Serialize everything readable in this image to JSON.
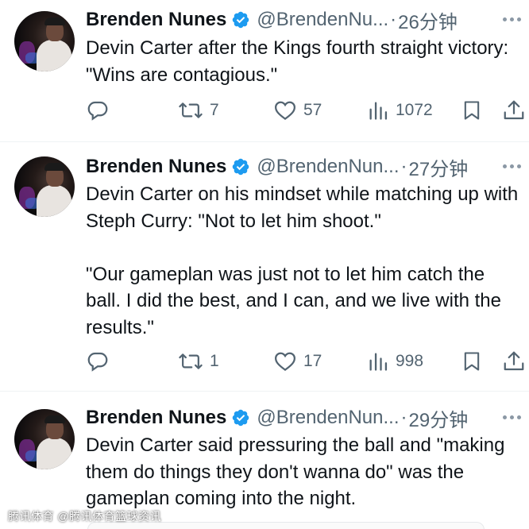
{
  "tweets": [
    {
      "author": "Brenden Nunes",
      "handle": "@BrendenNu...",
      "time": "26分钟",
      "text": "Devin Carter after the Kings fourth straight victory: \"Wins are contagious.\"",
      "retweets": "7",
      "likes": "57",
      "views": "1072"
    },
    {
      "author": "Brenden Nunes",
      "handle": "@BrendenNun...",
      "time": "27分钟",
      "text": "Devin Carter on his mindset while matching up with Steph Curry: \"Not to let him shoot.\"\n\n\"Our gameplan was just not to let him catch the ball. I did the best, and I can, and we live with the results.\"",
      "retweets": "1",
      "likes": "17",
      "views": "998"
    },
    {
      "author": "Brenden Nunes",
      "handle": "@BrendenNun...",
      "time": "29分钟",
      "text": "Devin Carter said pressuring the ball and \"making them do things they don't wanna do\" was the gameplan coming into the night."
    }
  ],
  "separator": "·",
  "watermark": "腾讯体育 @腾讯体育篮球资讯",
  "icons": {
    "verified": "verified-badge-icon",
    "reply": "reply-icon",
    "retweet": "retweet-icon",
    "like": "heart-icon",
    "views": "views-icon",
    "bookmark": "bookmark-icon",
    "share": "share-icon",
    "more": "more-dots-icon"
  },
  "colors": {
    "verified": "#1d9bf0",
    "muted": "#536471",
    "text": "#0f1419"
  }
}
